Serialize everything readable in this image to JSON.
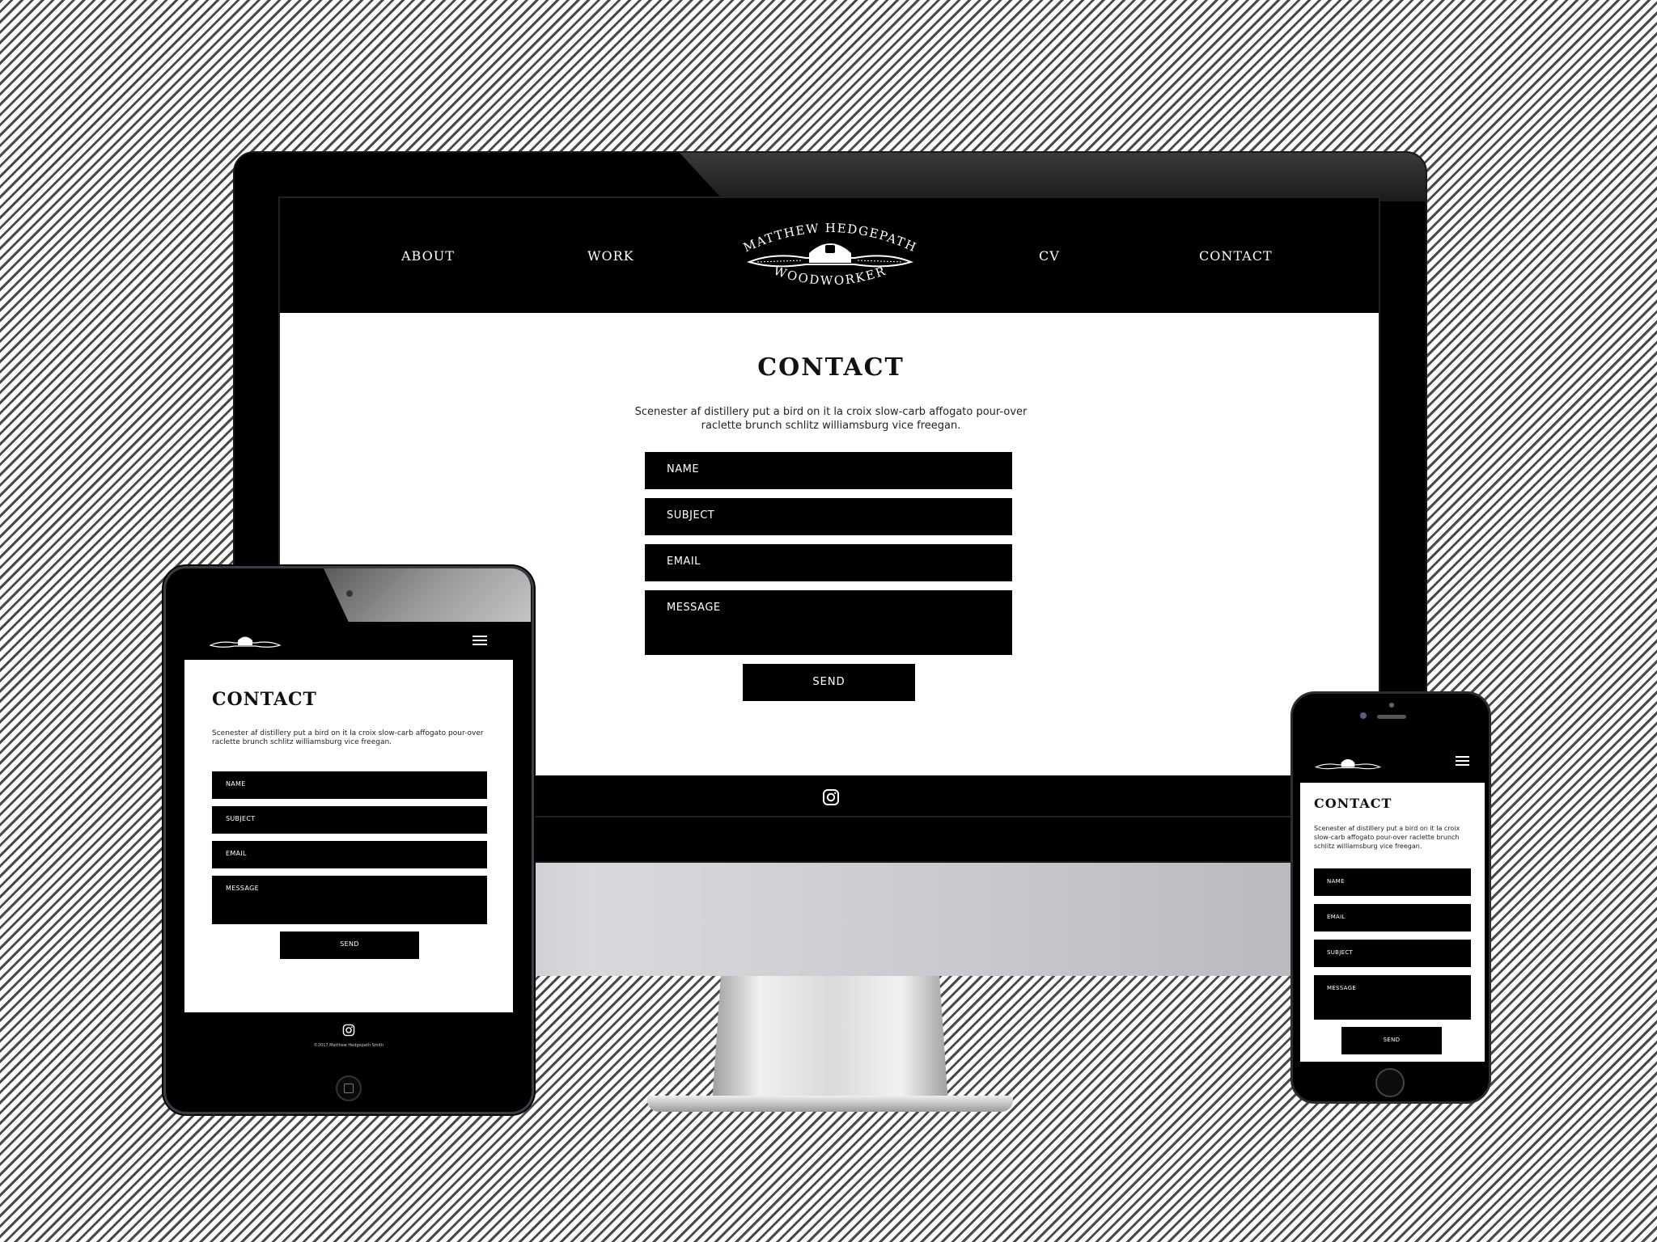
{
  "desktop": {
    "nav": {
      "about": "ABOUT",
      "work": "WORK",
      "cv": "CV",
      "contact": "CONTACT"
    },
    "logo": {
      "top": "MATTHEW HEDGEPATH",
      "bottom": "WOODWORKER"
    },
    "title": "CONTACT",
    "description": "Scenester af distillery put a bird on it la croix slow-carb affogato pour-over raclette brunch schlitz williamsburg vice freegan.",
    "fields": {
      "name": "NAME",
      "subject": "SUBJECT",
      "email": "EMAIL",
      "message": "MESSAGE"
    },
    "send": "SEND",
    "footer_icon": "instagram-icon"
  },
  "tablet": {
    "title": "CONTACT",
    "description": "Scenester af distillery put a bird on it la croix slow-carb affogato pour-over raclette brunch schlitz williamsburg vice freegan.",
    "fields": {
      "name": "NAME",
      "subject": "SUBJECT",
      "email": "EMAIL",
      "message": "MESSAGE"
    },
    "send": "SEND",
    "footer_icon": "instagram-icon",
    "copyright": "©2017 Matthew Hedgepath Smith"
  },
  "phone": {
    "title": "CONTACT",
    "description": "Scenester af distillery put a bird on it la croix slow-carb affogato pour-over raclette brunch schlitz williamsburg vice freegan.",
    "fields": {
      "name": "NAME",
      "email": "EMAIL",
      "subject": "SUBJECT",
      "message": "MESSAGE"
    },
    "send": "SEND"
  },
  "colors": {
    "background_stripe": "#4a4a4a",
    "ui_black": "#000000",
    "ui_white": "#ffffff"
  }
}
